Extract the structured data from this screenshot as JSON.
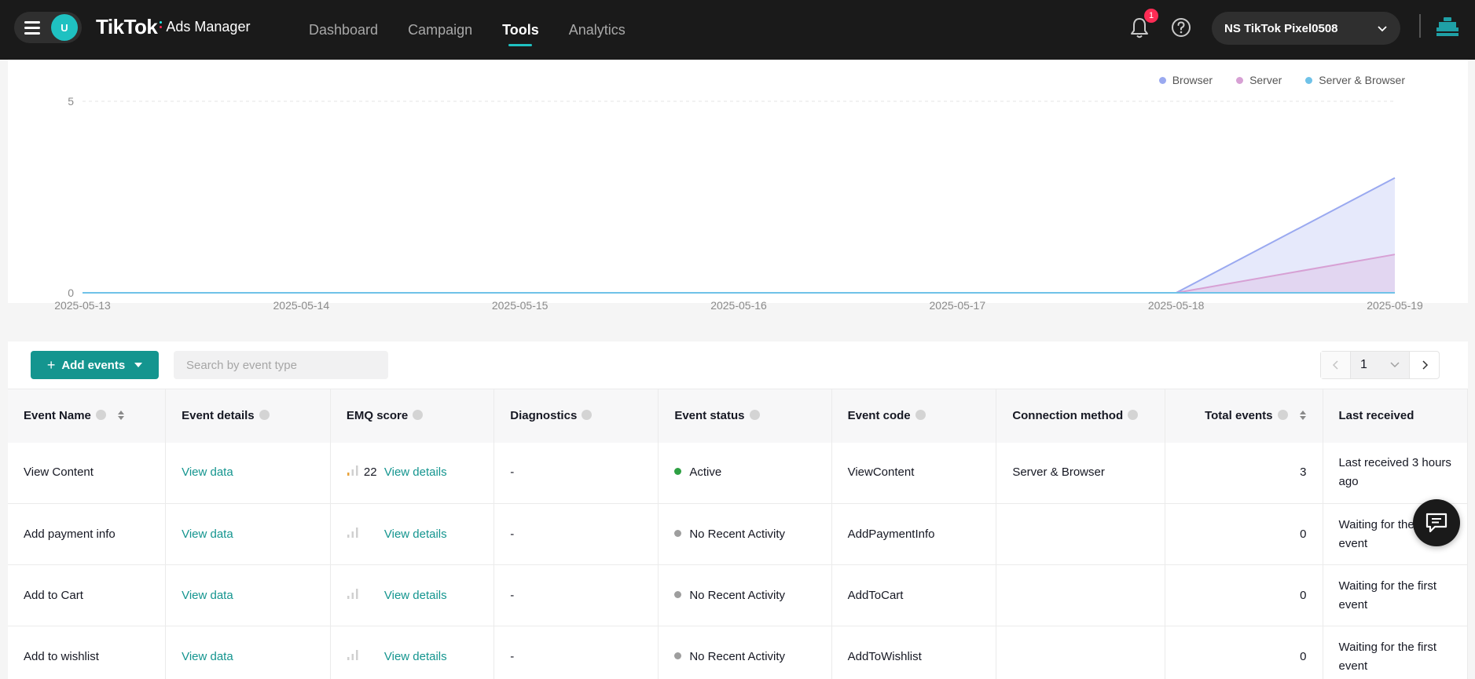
{
  "header": {
    "avatar_letter": "U",
    "logo_brand": "TikTok",
    "logo_product": "Ads Manager",
    "nav": [
      {
        "label": "Dashboard",
        "active": false
      },
      {
        "label": "Campaign",
        "active": false
      },
      {
        "label": "Tools",
        "active": true
      },
      {
        "label": "Analytics",
        "active": false
      }
    ],
    "notification_count": "1",
    "account_name": "NS TikTok Pixel0508"
  },
  "colors": {
    "accent": "#14958f",
    "nav_indicator": "#1fc1c1",
    "browser": "#9aa9f0",
    "server": "#d7a0d4",
    "server_browser": "#6fc2e8",
    "active": "#2ea043",
    "inactive": "#9e9e9e"
  },
  "chart_data": {
    "type": "area",
    "x": [
      "2025-05-13",
      "2025-05-14",
      "2025-05-15",
      "2025-05-16",
      "2025-05-17",
      "2025-05-18",
      "2025-05-19"
    ],
    "ylim": [
      0,
      5
    ],
    "yticks": [
      "0",
      "5"
    ],
    "grid": true,
    "legend_position": "top-right",
    "series": [
      {
        "name": "Browser",
        "values": [
          0,
          0,
          0,
          0,
          0,
          0,
          3
        ],
        "color": "#9aa9f0"
      },
      {
        "name": "Server",
        "values": [
          0,
          0,
          0,
          0,
          0,
          0,
          1
        ],
        "color": "#d7a0d4"
      },
      {
        "name": "Server & Browser",
        "values": [
          0,
          0,
          0,
          0,
          0,
          0,
          0
        ],
        "color": "#6fc2e8"
      }
    ]
  },
  "toolbar": {
    "add_events_label": "Add events",
    "search_placeholder": "Search by event type",
    "page_number": "1"
  },
  "table": {
    "columns": [
      "Event Name",
      "Event details",
      "EMQ score",
      "Diagnostics",
      "Event status",
      "Event code",
      "Connection method",
      "Total events",
      "Last received"
    ],
    "rows": [
      {
        "name": "View Content",
        "details": "View data",
        "emq_score": "22",
        "emq_link": "View details",
        "diagnostics": "-",
        "status": "Active",
        "status_kind": "active",
        "code": "ViewContent",
        "connection": "Server & Browser",
        "total": "3",
        "last_received": "Last received 3 hours ago",
        "last_line1": "Last received 3 hours",
        "last_line2": "ago"
      },
      {
        "name": "Add payment info",
        "details": "View data",
        "emq_score": "",
        "emq_link": "View details",
        "diagnostics": "-",
        "status": "No Recent Activity",
        "status_kind": "inactive",
        "code": "AddPaymentInfo",
        "connection": "",
        "total": "0",
        "last_line1": "Waiting for the first",
        "last_line2": "event"
      },
      {
        "name": "Add to Cart",
        "details": "View data",
        "emq_score": "",
        "emq_link": "View details",
        "diagnostics": "-",
        "status": "No Recent Activity",
        "status_kind": "inactive",
        "code": "AddToCart",
        "connection": "",
        "total": "0",
        "last_line1": "Waiting for the first",
        "last_line2": "event"
      },
      {
        "name": "Add to wishlist",
        "details": "View data",
        "emq_score": "",
        "emq_link": "View details",
        "diagnostics": "-",
        "status": "No Recent Activity",
        "status_kind": "inactive",
        "code": "AddToWishlist",
        "connection": "",
        "total": "0",
        "last_line1": "Waiting for the first",
        "last_line2": "event"
      }
    ]
  },
  "icons": {
    "menu": "hamburger-icon",
    "notifications": "bell-icon",
    "help": "question-circle-icon",
    "account_dropdown": "chevron-down-icon",
    "workspace": "seat-icon",
    "chat": "chat-icon"
  }
}
